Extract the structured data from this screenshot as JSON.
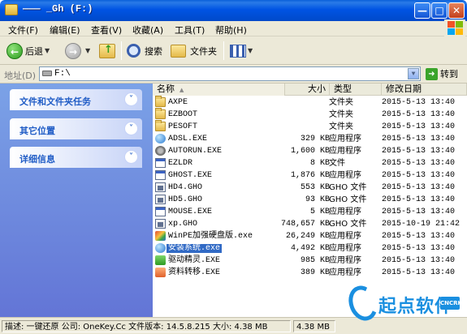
{
  "window": {
    "title": "_Gh (F:)",
    "title_prefix": "——— "
  },
  "menu": [
    "文件(F)",
    "编辑(E)",
    "查看(V)",
    "收藏(A)",
    "工具(T)",
    "帮助(H)"
  ],
  "toolbar": {
    "back_label": "后退",
    "search_label": "搜索",
    "folders_label": "文件夹"
  },
  "address": {
    "label": "地址(D)",
    "value": "F:\\",
    "go_label": "转到"
  },
  "tasks": [
    {
      "title": "文件和文件夹任务"
    },
    {
      "title": "其它位置"
    },
    {
      "title": "详细信息"
    }
  ],
  "columns": {
    "name": "名称",
    "size": "大小",
    "type": "类型",
    "modified": "修改日期"
  },
  "files": [
    {
      "name": "AXPE",
      "size": "",
      "type": "文件夹",
      "modified": "2015-5-13 13:40",
      "icon": "folder-icon"
    },
    {
      "name": "EZBOOT",
      "size": "",
      "type": "文件夹",
      "modified": "2015-5-13 13:40",
      "icon": "folder-icon"
    },
    {
      "name": "PESOFT",
      "size": "",
      "type": "文件夹",
      "modified": "2015-5-13 13:40",
      "icon": "folder-icon"
    },
    {
      "name": "ADSL.EXE",
      "size": "329 KB",
      "type": "应用程序",
      "modified": "2015-5-13 13:40",
      "icon": "network-app-icon"
    },
    {
      "name": "AUTORUN.EXE",
      "size": "1,600 KB",
      "type": "应用程序",
      "modified": "2015-5-13 13:40",
      "icon": "gear-app-icon"
    },
    {
      "name": "EZLDR",
      "size": "8 KB",
      "type": "文件",
      "modified": "2015-5-13 13:40",
      "icon": "file-icon"
    },
    {
      "name": "GHOST.EXE",
      "size": "1,876 KB",
      "type": "应用程序",
      "modified": "2015-5-13 13:40",
      "icon": "app-window-icon"
    },
    {
      "name": "HD4.GHO",
      "size": "553 KB",
      "type": "GHO 文件",
      "modified": "2015-5-13 13:40",
      "icon": "gho-file-icon"
    },
    {
      "name": "HD5.GHO",
      "size": "93 KB",
      "type": "GHO 文件",
      "modified": "2015-5-13 13:40",
      "icon": "gho-file-icon"
    },
    {
      "name": "MOUSE.EXE",
      "size": "5 KB",
      "type": "应用程序",
      "modified": "2015-5-13 13:40",
      "icon": "app-window-icon"
    },
    {
      "name": "xp.GHO",
      "size": "748,657 KB",
      "type": "GHO 文件",
      "modified": "2015-10-19 21:42",
      "icon": "gho-file-icon"
    },
    {
      "name": "WinPE加强硬盘版.exe",
      "size": "26,249 KB",
      "type": "应用程序",
      "modified": "2015-5-13 13:40",
      "icon": "colorful-app-icon"
    },
    {
      "name": "安装系统.exe",
      "size": "4,492 KB",
      "type": "应用程序",
      "modified": "2015-5-13 13:40",
      "icon": "globe-app-icon",
      "selected": true
    },
    {
      "name": "驱动精灵.EXE",
      "size": "985 KB",
      "type": "应用程序",
      "modified": "2015-5-13 13:40",
      "icon": "driver-app-icon"
    },
    {
      "name": "资料转移.EXE",
      "size": "389 KB",
      "type": "应用程序",
      "modified": "2015-5-13 13:40",
      "icon": "transfer-app-icon"
    }
  ],
  "status": {
    "description": "描述: 一键还原 公司: OneKey.Cc 文件版本: 14.5.8.215 大小: 4.38 MB",
    "size": "4.38 MB"
  },
  "watermark": {
    "text": "起点软件",
    "badge": "CNCRK"
  },
  "colors": {
    "titlebar": "#0054e3",
    "left_pane": "#7ba2e7",
    "selection": "#316ac5",
    "task_title": "#215dc6",
    "watermark": "#1a8fe0"
  }
}
